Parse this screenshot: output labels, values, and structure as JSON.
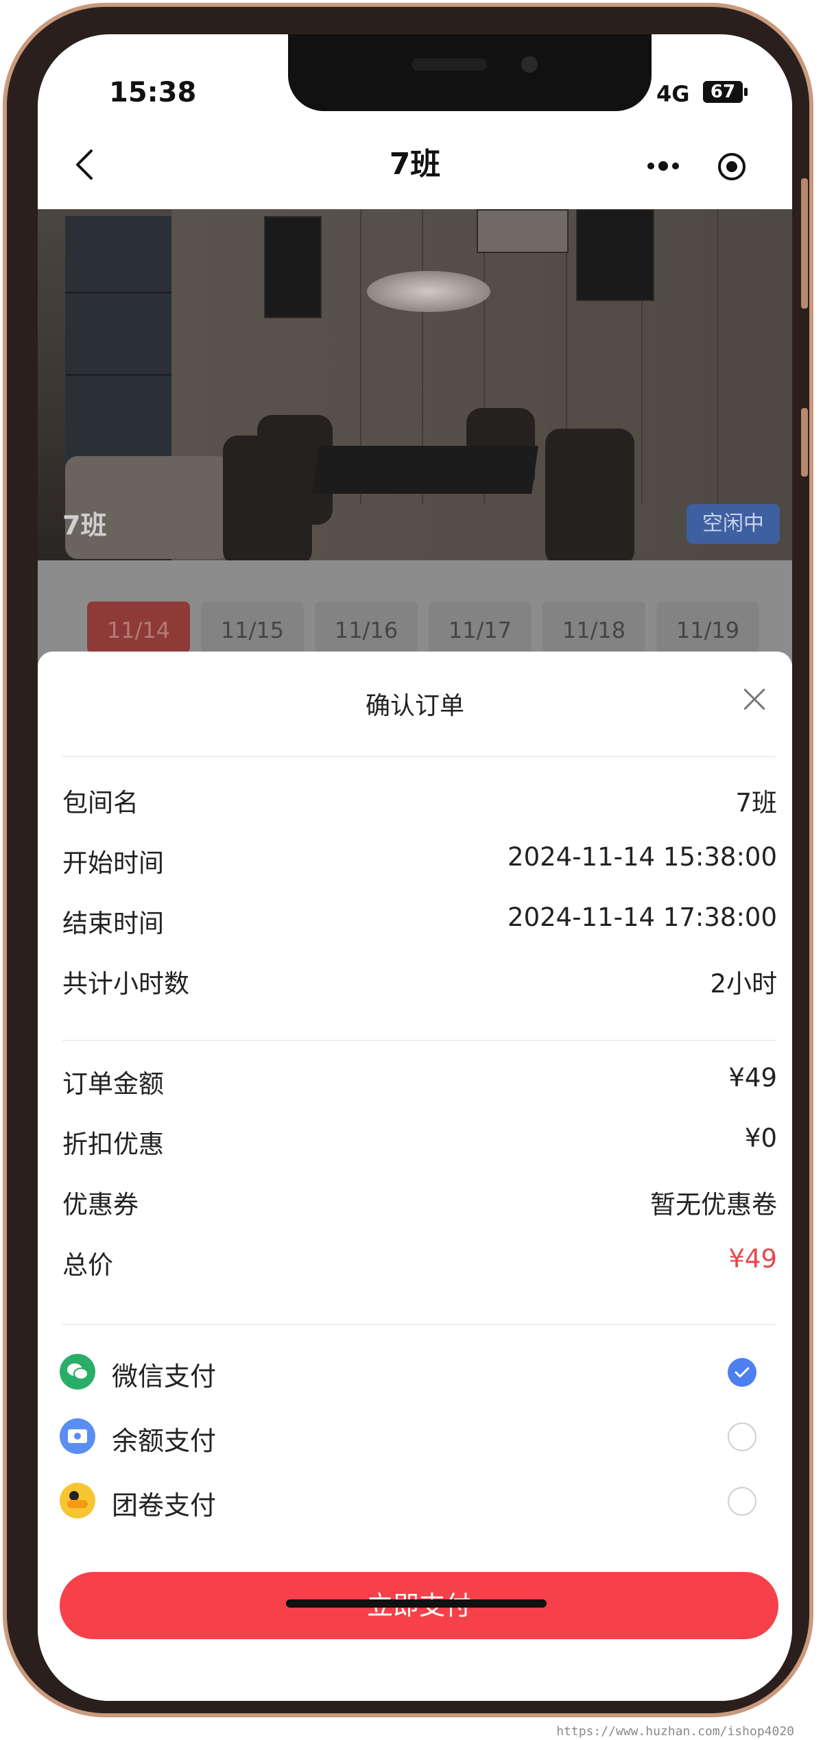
{
  "status_bar": {
    "time": "15:38",
    "network": "4G",
    "battery": "67"
  },
  "nav": {
    "title": "7班"
  },
  "hero": {
    "room_label": "7班",
    "status_badge": "空闲中"
  },
  "date_tabs": [
    {
      "label": "11/14",
      "active": true
    },
    {
      "label": "11/15",
      "active": false
    },
    {
      "label": "11/16",
      "active": false
    },
    {
      "label": "11/17",
      "active": false
    },
    {
      "label": "11/18",
      "active": false
    },
    {
      "label": "11/19",
      "active": false
    }
  ],
  "sheet": {
    "title": "确认订单",
    "booking": [
      {
        "label": "包间名",
        "value": "7班"
      },
      {
        "label": "开始时间",
        "value": "2024-11-14 15:38:00"
      },
      {
        "label": "结束时间",
        "value": "2024-11-14 17:38:00"
      },
      {
        "label": "共计小时数",
        "value": "2小时"
      }
    ],
    "pricing": [
      {
        "label": "订单金额",
        "value": "¥49"
      },
      {
        "label": "折扣优惠",
        "value": "¥0"
      },
      {
        "label": "优惠券",
        "value": "暂无优惠卷"
      },
      {
        "label": "总价",
        "value": "¥49"
      }
    ],
    "payment_methods": [
      {
        "label": "微信支付",
        "icon": "wechat-pay-icon",
        "selected": true
      },
      {
        "label": "余额支付",
        "icon": "balance-pay-icon",
        "selected": false
      },
      {
        "label": "团卷支付",
        "icon": "meituan-coupon-icon",
        "selected": false
      }
    ],
    "pay_button": "立即支付"
  },
  "colors": {
    "accent_red": "#f6414a",
    "price_red": "#e5484d",
    "check_blue": "#4d7ff0",
    "wechat_green": "#2aae67"
  },
  "watermark": "https://www.huzhan.com/ishop4020"
}
